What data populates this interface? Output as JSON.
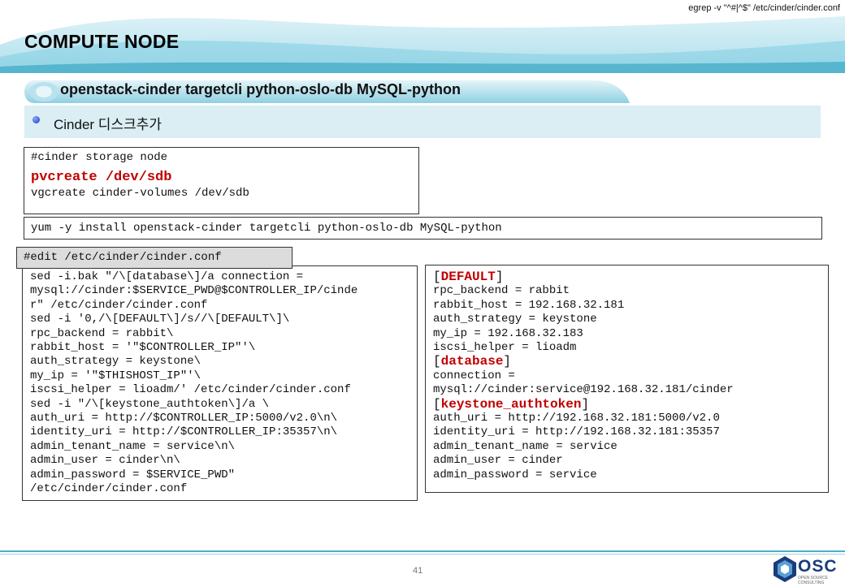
{
  "header": {
    "command": "egrep -v \"^#|^$\" /etc/cinder/cinder.conf",
    "title": "COMPUTE NODE"
  },
  "packages_bar": {
    "title": "openstack-cinder targetcli  python-oslo-db MySQL-python"
  },
  "subheading": {
    "text": "Cinder 디스크추가"
  },
  "storage_box": {
    "comment": "#cinder storage node",
    "pv_cmd": "pvcreate",
    "pv_arg": "/dev/sdb",
    "vg_line": "vgcreate cinder-volumes /dev/sdb"
  },
  "install_box": {
    "line": "yum -y install openstack-cinder targetcli python-oslo-db MySQL-python"
  },
  "edit_label": "#edit  /etc/cinder/cinder.conf",
  "sed_box": {
    "lines": [
      "sed -i.bak \"/\\[database\\]/a connection =",
      "mysql://cinder:$SERVICE_PWD@$CONTROLLER_IP/cinde",
      "r\" /etc/cinder/cinder.conf",
      "sed -i '0,/\\[DEFAULT\\]/s//\\[DEFAULT\\]\\",
      "rpc_backend = rabbit\\",
      "rabbit_host = '\"$CONTROLLER_IP\"'\\",
      "auth_strategy = keystone\\",
      "my_ip = '\"$THISHOST_IP\"'\\",
      "iscsi_helper = lioadm/' /etc/cinder/cinder.conf",
      "sed -i \"/\\[keystone_authtoken\\]/a \\",
      "auth_uri = http://$CONTROLLER_IP:5000/v2.0\\n\\",
      "identity_uri = http://$CONTROLLER_IP:35357\\n\\",
      "admin_tenant_name = service\\n\\",
      "admin_user = cinder\\n\\",
      "admin_password = $SERVICE_PWD\"",
      "/etc/cinder/cinder.conf"
    ]
  },
  "conf_box": {
    "default_section": "DEFAULT",
    "default_lines": [
      "rpc_backend = rabbit",
      "rabbit_host = 192.168.32.181",
      "auth_strategy = keystone",
      "my_ip = 192.168.32.183",
      "iscsi_helper = lioadm"
    ],
    "database_section": "database",
    "database_lines": [
      "connection =",
      "mysql://cinder:service@192.168.32.181/cinder"
    ],
    "keystone_section": "keystone_authtoken",
    "keystone_lines": [
      "auth_uri = http://192.168.32.181:5000/v2.0",
      "identity_uri = http://192.168.32.181:35357",
      "admin_tenant_name = service",
      "admin_user = cinder",
      "admin_password = service"
    ]
  },
  "footer": {
    "page_number": "41",
    "logo_text": "OSC",
    "logo_subtext": "OPEN SOURCE CONSULTING"
  },
  "colors": {
    "accent_teal": "#4bb0c8",
    "highlight_red": "#c00000",
    "band_light": "#daeef4"
  }
}
